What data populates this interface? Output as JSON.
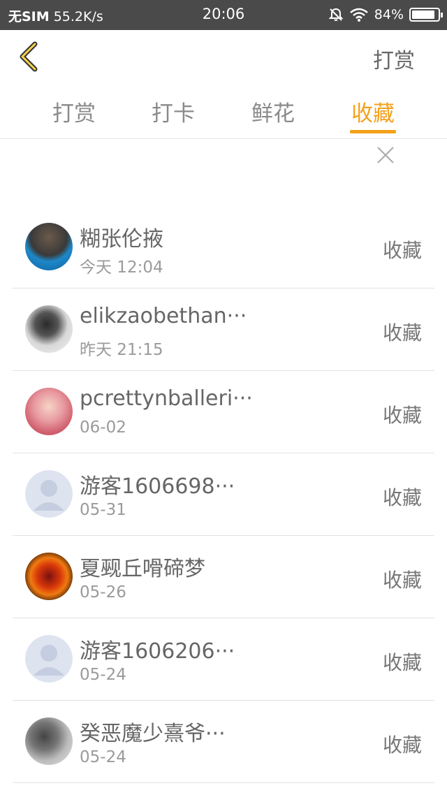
{
  "status_bar": {
    "carrier": "无SIM",
    "speed": "55.2K/s",
    "time": "20:06",
    "battery": "84%",
    "icons": [
      "mute-bell-icon",
      "wifi-icon",
      "battery-icon"
    ]
  },
  "nav": {
    "back_icon": "chevron-left-icon",
    "action_label": "打赏"
  },
  "tabs": [
    {
      "label": "打赏",
      "active": false
    },
    {
      "label": "打卡",
      "active": false
    },
    {
      "label": "鲜花",
      "active": false
    },
    {
      "label": "收藏",
      "active": true
    }
  ],
  "close_icon": "close-icon",
  "entries": [
    {
      "name": "糊张伦掖",
      "date": "今天 12:04",
      "action": "收藏"
    },
    {
      "name": "elikzaobethan···",
      "date": "昨天 21:15",
      "action": "收藏"
    },
    {
      "name": "pcrettynballeri···",
      "date": "06-02",
      "action": "收藏"
    },
    {
      "name": "游客1606698···",
      "date": "05-31",
      "action": "收藏"
    },
    {
      "name": "夏觋丘嗗碲梦",
      "date": "05-26",
      "action": "收藏"
    },
    {
      "name": "游客1606206···",
      "date": "05-24",
      "action": "收藏"
    },
    {
      "name": "癸恶魔少熹爷···",
      "date": "05-24",
      "action": "收藏"
    }
  ],
  "colors": {
    "accent": "#f4a11c",
    "status_bar": "#4a4a4a",
    "divider": "#e2e2e2"
  }
}
